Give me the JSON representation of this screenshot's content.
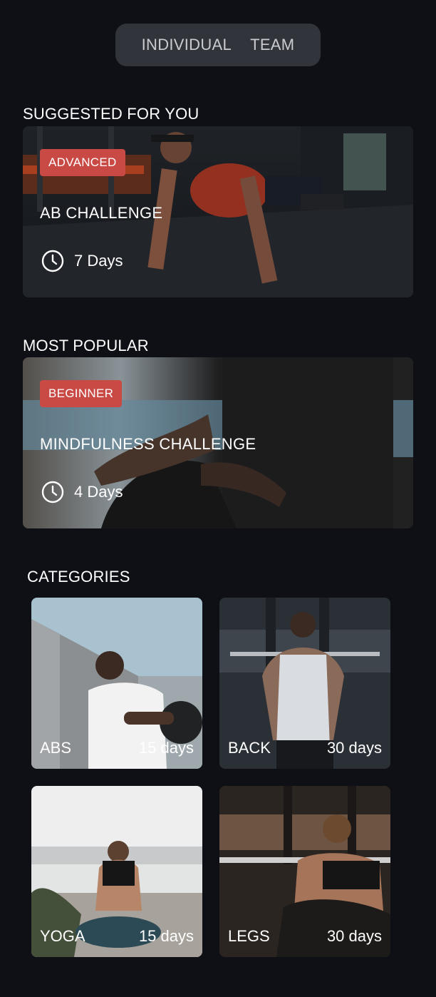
{
  "tabs": {
    "individual": "INDIVIDUAL",
    "team": "TEAM"
  },
  "sections": {
    "suggested": "SUGGESTED FOR YOU",
    "popular": "MOST POPULAR",
    "categories": "CATEGORIES"
  },
  "suggested_card": {
    "level": "ADVANCED",
    "title": "AB CHALLENGE",
    "duration": "7 Days"
  },
  "popular_card": {
    "level": "BEGINNER",
    "title": "MINDFULNESS CHALLENGE",
    "duration": "4 Days"
  },
  "categories": [
    {
      "name": "ABS",
      "days": "15 days"
    },
    {
      "name": "BACK",
      "days": "30 days"
    },
    {
      "name": "YOGA",
      "days": "15 days"
    },
    {
      "name": "LEGS",
      "days": "30 days"
    }
  ],
  "colors": {
    "background": "#0e1015",
    "badge": "#c94a45",
    "toggle": "#31343a"
  },
  "icons": {
    "duration": "clock-icon"
  }
}
